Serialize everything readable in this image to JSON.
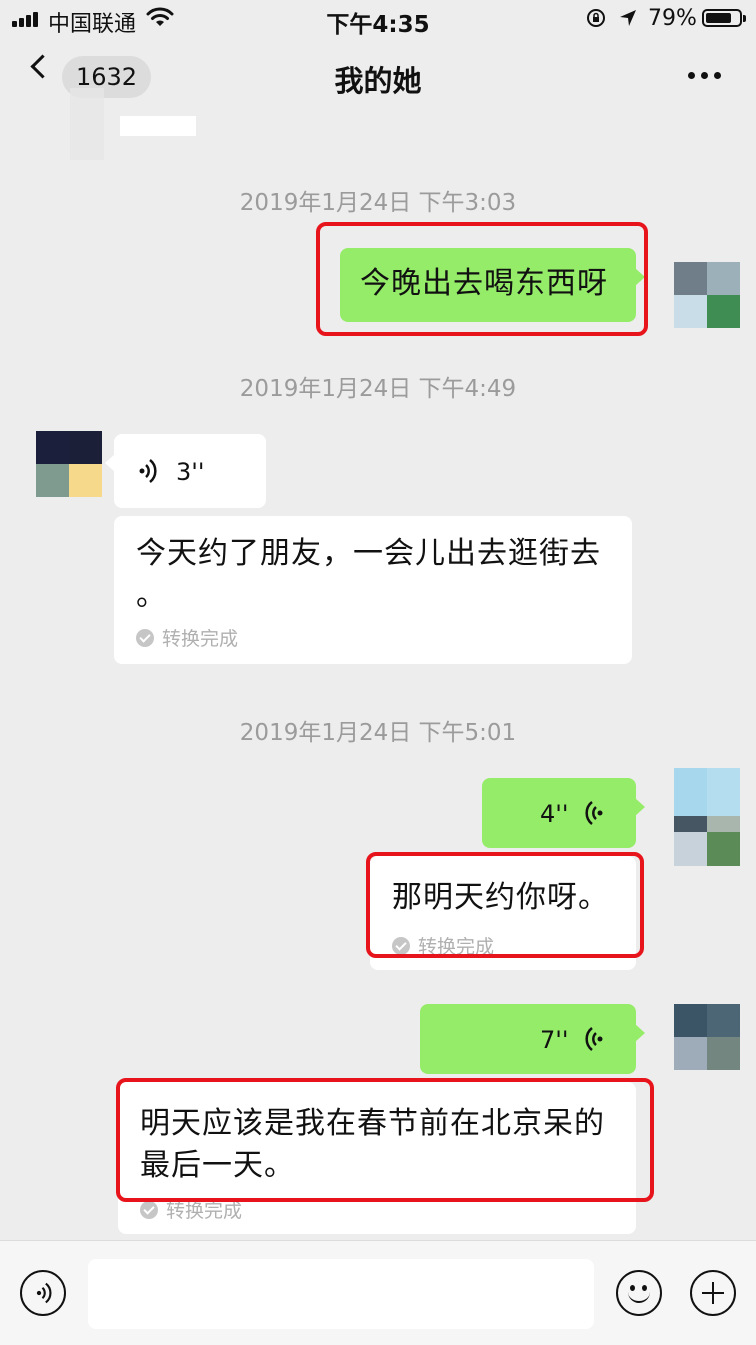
{
  "status_bar": {
    "carrier": "中国联通",
    "time": "下午4:35",
    "battery_percent": "79%",
    "battery_level": 0.79
  },
  "nav": {
    "unread_count": "1632",
    "title": "我的她"
  },
  "messages": {
    "ts1": "2019年1月24日 下午3:03",
    "m1_text": "今晚出去喝东西呀",
    "ts2": "2019年1月24日 下午4:49",
    "m2_duration": "3''",
    "m2_transcript_line1": "今天约了朋友，一会儿出去逛街去",
    "m2_transcript_line2": "。",
    "m2_status": "转换完成",
    "ts3": "2019年1月24日 下午5:01",
    "m3_duration": "4''",
    "m3_transcript": "那明天约你呀。",
    "m3_status": "转换完成",
    "m4_duration": "7''",
    "m4_transcript_line1": "明天应该是我在春节前在北京呆的",
    "m4_transcript_line2": "最后一天。",
    "m4_status": "转换完成"
  },
  "colors": {
    "sent_bubble": "#95ec69",
    "received_bubble": "#ffffff",
    "highlight_border": "#e8141c",
    "background": "#ededed"
  },
  "icons": [
    "signal-icon",
    "wifi-icon",
    "orientation-lock-icon",
    "location-icon",
    "battery-icon",
    "back-chevron-icon",
    "more-icon",
    "voice-icon",
    "check-icon",
    "voice-input-icon",
    "emoji-icon",
    "plus-icon"
  ]
}
